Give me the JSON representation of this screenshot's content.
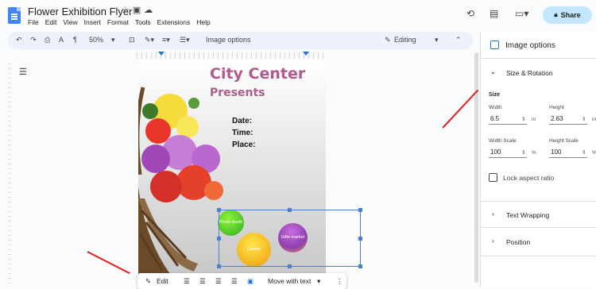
{
  "header": {
    "doc_title": "Flower Exhibition Flyer",
    "menu": [
      "File",
      "Edit",
      "View",
      "Insert",
      "Format",
      "Tools",
      "Extensions",
      "Help"
    ],
    "share_label": "Share"
  },
  "toolbar": {
    "zoom": "50%",
    "image_options": "Image options",
    "mode": "Editing"
  },
  "flyer": {
    "title": "City Center",
    "subtitle": "Presents",
    "date_label": "Date:",
    "time_label": "Time:",
    "place_label": "Place:",
    "bubble1": "Photo booth",
    "bubble2": "Gifts market",
    "bubble3": "Games"
  },
  "image_toolbar": {
    "edit_label": "Edit",
    "wrap_label": "Move with text"
  },
  "panel": {
    "title": "Image options",
    "section_size": "Size & Rotation",
    "size_heading": "Size",
    "width_label": "Width",
    "width_value": "6.5",
    "height_label": "Height",
    "height_value": "2.63",
    "unit_in": "in",
    "width_scale_label": "Width Scale",
    "width_scale_value": "100",
    "height_scale_label": "Height Scale",
    "height_scale_value": "100",
    "unit_pct": "%",
    "lock_label": "Lock aspect ratio",
    "section_wrap": "Text Wrapping",
    "section_position": "Position"
  },
  "colors": {
    "accent": "#1a73e8",
    "title_pink": "#b05a8e",
    "share_bg": "#c2e7ff",
    "arrow_red": "#e01f1f"
  }
}
